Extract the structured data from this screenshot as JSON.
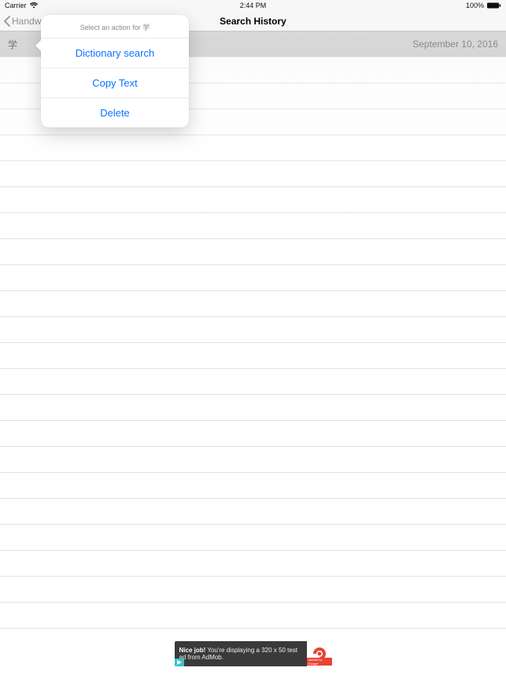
{
  "status_bar": {
    "carrier": "Carrier",
    "time": "2:44 PM",
    "battery_pct": "100%"
  },
  "nav": {
    "back_label": "Handw",
    "title": "Search History"
  },
  "list": {
    "rows": [
      {
        "char": "学",
        "date": "September 10, 2016"
      }
    ]
  },
  "popover": {
    "title_prefix": "Select an action for ",
    "title_char": "学",
    "items": [
      "Dictionary search",
      "Copy Text",
      "Delete"
    ]
  },
  "ad": {
    "bold": "Nice job!",
    "text": " You're displaying a 320 x 50 test ad from AdMob.",
    "sub": "AdMob by Google"
  }
}
